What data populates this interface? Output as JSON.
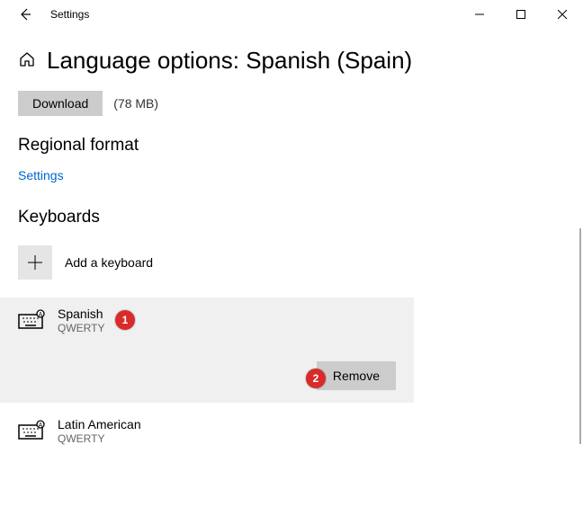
{
  "window": {
    "app_title": "Settings"
  },
  "page": {
    "title": "Language options: Spanish (Spain)",
    "download_label": "Download",
    "download_size": "(78 MB)"
  },
  "regional": {
    "heading": "Regional format",
    "link": "Settings"
  },
  "keyboards": {
    "heading": "Keyboards",
    "add_label": "Add a keyboard",
    "items": [
      {
        "name": "Spanish",
        "layout": "QWERTY"
      },
      {
        "name": "Latin American",
        "layout": "QWERTY"
      }
    ],
    "remove_label": "Remove"
  },
  "badges": {
    "one": "1",
    "two": "2"
  }
}
